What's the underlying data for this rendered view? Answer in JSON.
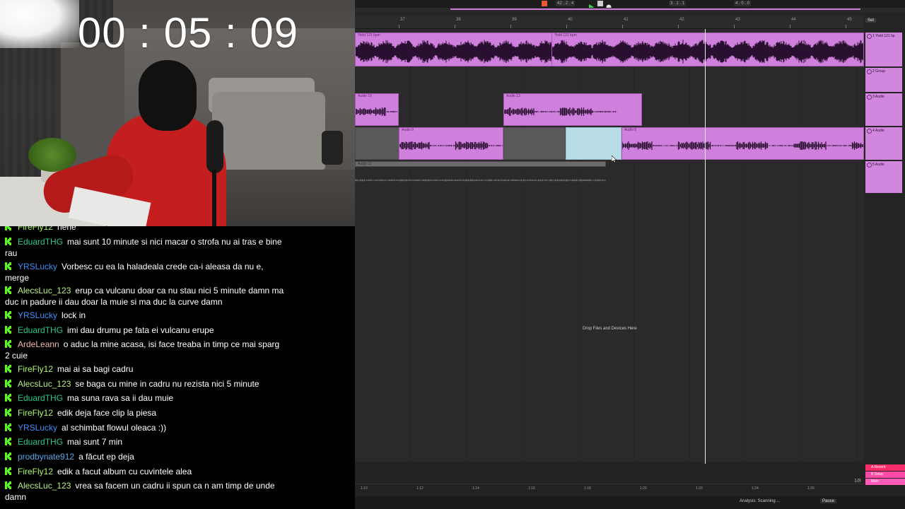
{
  "overlay": {
    "timer": "00 : 05 : 09"
  },
  "chat": {
    "badge_icon": "kick-k-icon",
    "badge_color": "#53fc18",
    "messages": [
      {
        "user": "FireFly12",
        "color": "#adf76a",
        "text": "hehe"
      },
      {
        "user": "EduardTHG",
        "color": "#29c98a",
        "text": "mai sunt 10 minute si nici macar o strofa nu ai tras e bine rau"
      },
      {
        "user": "YRSLucky",
        "color": "#3f8ff7",
        "text": "Vorbesc cu ea la haladeala crede ca-i aleasa da nu e, merge"
      },
      {
        "user": "AlecsLuc_123",
        "color": "#b7f27c",
        "text": "erup ca vulcanu doar ca nu stau nici 5 minute damn ma duc in padure ii dau doar la muie si ma duc la curve damn"
      },
      {
        "user": "YRSLucky",
        "color": "#3f8ff7",
        "text": "lock in"
      },
      {
        "user": "EduardTHG",
        "color": "#29c98a",
        "text": "imi dau drumu pe fata ei vulcanu erupe"
      },
      {
        "user": "ArdeLeann",
        "color": "#f2b6ad",
        "text": "o aduc la mine acasa, isi face treaba in timp ce mai sparg 2 cuie"
      },
      {
        "user": "FireFly12",
        "color": "#adf76a",
        "text": "mai ai sa bagi cadru"
      },
      {
        "user": "AlecsLuc_123",
        "color": "#b7f27c",
        "text": "se baga cu mine in cadru nu rezista nici 5 minute"
      },
      {
        "user": "EduardTHG",
        "color": "#29c98a",
        "text": "ma suna rava sa ii dau muie"
      },
      {
        "user": "FireFly12",
        "color": "#adf76a",
        "text": "edik deja face clip la piesa"
      },
      {
        "user": "YRSLucky",
        "color": "#3f8ff7",
        "text": "al schimbat flowul oleaca :))"
      },
      {
        "user": "EduardTHG",
        "color": "#29c98a",
        "text": "mai sunt 7 min"
      },
      {
        "user": "prodbynate912",
        "color": "#5aa7e8",
        "text": "a făcut ep deja"
      },
      {
        "user": "FireFly12",
        "color": "#adf76a",
        "text": "edik a facut album cu cuvintele alea"
      },
      {
        "user": "AlecsLuc_123",
        "color": "#b7f27c",
        "text": "vrea sa facem un cadru ii spun ca n am timp de unde damn"
      }
    ]
  },
  "daw": {
    "transport": {
      "tempo": "42 . 2 . 4",
      "position": "3 . 1 . 1",
      "end": "4 . 0 . 0"
    },
    "ruler_bars": [
      "37",
      "38",
      "39",
      "40",
      "41",
      "42",
      "43",
      "44",
      "45"
    ],
    "set_button": "Set",
    "clips": {
      "yield_1": "Yield 121 bpm",
      "yield_2": "Yield 121 bpm",
      "audio_10": "Audio 10",
      "audio_13": "Audio 13",
      "audio_9": "Audio 9",
      "audio_8": "Audio 8",
      "audio_11": "Audio 11"
    },
    "tracks": [
      {
        "label": "1 Yield 121 bp"
      },
      {
        "label": "2 Group"
      },
      {
        "label": "3 Audio"
      },
      {
        "label": "4 Audio"
      },
      {
        "label": "5 Audio"
      }
    ],
    "drop_hint": "Drop Files and Devices Here",
    "time_ticks": [
      "1:10",
      "1:12",
      "1:14",
      "1:16",
      "1:18",
      "1:20",
      "1:22",
      "1:24",
      "1:26"
    ],
    "quantize": "1/8",
    "returns": [
      "A Reverb",
      "B Delay",
      "Main"
    ],
    "zoom": "0.00",
    "status": "Analysis: Scanning ...",
    "pause_label": "Pause",
    "accent": "#cf7fdc",
    "selection_color": "#b9dde6"
  }
}
